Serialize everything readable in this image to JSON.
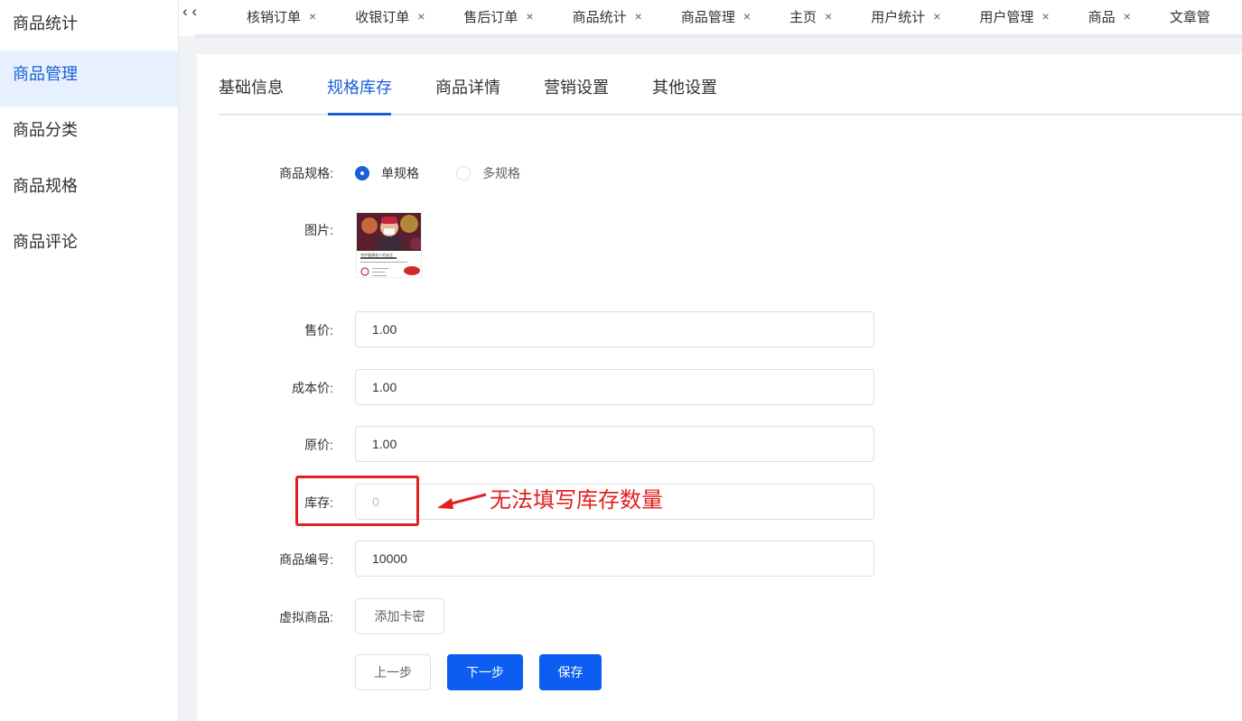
{
  "sidebar": {
    "items": [
      {
        "label": "商品统计",
        "active": false
      },
      {
        "label": "商品管理",
        "active": true
      },
      {
        "label": "商品分类",
        "active": false
      },
      {
        "label": "商品规格",
        "active": false
      },
      {
        "label": "商品评论",
        "active": false
      }
    ]
  },
  "tabbar": {
    "prev_glyph": "‹ ‹",
    "close_glyph": "×",
    "tabs": [
      {
        "label": "核销订单"
      },
      {
        "label": "收银订单"
      },
      {
        "label": "售后订单"
      },
      {
        "label": "商品统计"
      },
      {
        "label": "商品管理"
      },
      {
        "label": "主页"
      },
      {
        "label": "用户统计"
      },
      {
        "label": "用户管理"
      },
      {
        "label": "商品"
      },
      {
        "label": "文章管"
      }
    ]
  },
  "form_tabs": [
    {
      "label": "基础信息",
      "active": false
    },
    {
      "label": "规格库存",
      "active": true
    },
    {
      "label": "商品详情",
      "active": false
    },
    {
      "label": "营销设置",
      "active": false
    },
    {
      "label": "其他设置",
      "active": false
    }
  ],
  "form": {
    "spec_label": "商品规格:",
    "spec_options": [
      {
        "label": "单规格",
        "checked": true
      },
      {
        "label": "多规格",
        "checked": false
      }
    ],
    "image_label": "图片:",
    "image_caption": "守护健康老人的安全",
    "price_label": "售价:",
    "price_value": "1.00",
    "cost_label": "成本价:",
    "cost_value": "1.00",
    "original_label": "原价:",
    "original_value": "1.00",
    "stock_label": "库存:",
    "stock_placeholder": "0",
    "sku_label": "商品编号:",
    "sku_value": "10000",
    "virtual_label": "虚拟商品:",
    "add_card_label": "添加卡密"
  },
  "actions": {
    "prev_label": "上一步",
    "next_label": "下一步",
    "save_label": "保存"
  },
  "annotation": {
    "text": "无法填写库存数量",
    "color": "#e0221f"
  },
  "colors": {
    "accent": "#1a5fd6",
    "primary_button": "#0d5ef0"
  }
}
